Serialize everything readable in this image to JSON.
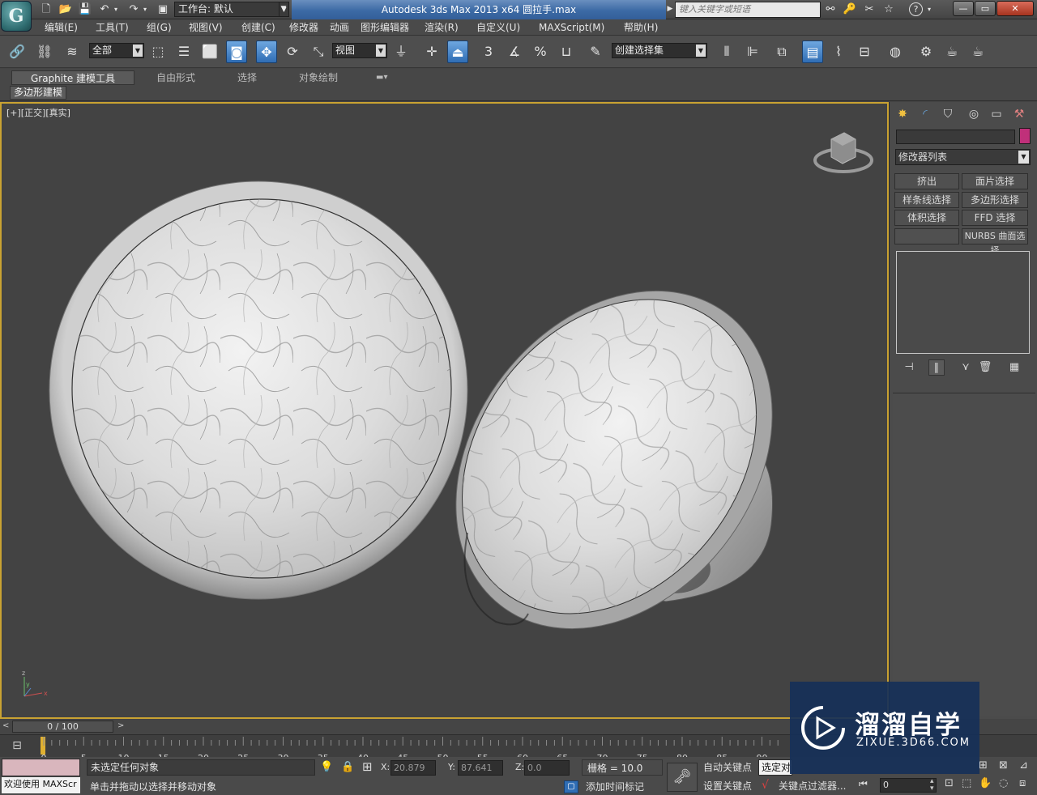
{
  "titlebar": {
    "workspace_label": "工作台: 默认",
    "window_title": "Autodesk 3ds Max  2013 x64      圆拉手.max",
    "search_placeholder": "键入关键字或短语",
    "min": "—",
    "max": "▭",
    "close": "✕"
  },
  "menus": [
    "编辑(E)",
    "工具(T)",
    "组(G)",
    "视图(V)",
    "创建(C)",
    "修改器",
    "动画",
    "图形编辑器",
    "渲染(R)",
    "自定义(U)",
    "MAXScript(M)",
    "帮助(H)"
  ],
  "toolbar": {
    "filter_value": "全部",
    "refcoord_value": "视图",
    "selection_set_value": "创建选择集",
    "snap_3": "3",
    "percent": "%"
  },
  "ribbon": {
    "tabs": [
      "Graphite 建模工具",
      "自由形式",
      "选择",
      "对象绘制"
    ],
    "active_panel": "多边形建模"
  },
  "viewport": {
    "label": "[+][正交][真实]"
  },
  "command_panel": {
    "modifier_list": "修改器列表",
    "buttons": [
      "挤出",
      "面片选择",
      "样条线选择",
      "多边形选择",
      "体积选择",
      "FFD 选择",
      "",
      "NURBS 曲面选择"
    ]
  },
  "timeline": {
    "frame_display": "0 / 100",
    "ticks": [
      "0",
      "5",
      "10",
      "15",
      "20",
      "25",
      "30",
      "35",
      "40",
      "45",
      "50",
      "55",
      "60",
      "65",
      "70",
      "75",
      "80",
      "85",
      "90"
    ]
  },
  "status": {
    "welcome": "欢迎使用 MAXScr",
    "selection_status": "未选定任何对象",
    "prompt": "单击并拖动以选择并移动对象",
    "x_label": "X:",
    "x_value": "20.879",
    "y_label": "Y:",
    "y_value": "87.641",
    "z_label": "Z:",
    "z_value": "0.0",
    "grid": "栅格 = 10.0",
    "add_time_tag": "添加时间标记",
    "auto_key": "自动关键点",
    "set_key": "设置关键点",
    "selected_object": "选定对",
    "key_filters": "关键点过滤器...",
    "frame_value": "0"
  },
  "watermark": {
    "brand": "溜溜自学",
    "url": "ZIXUE.3D66.COM"
  }
}
